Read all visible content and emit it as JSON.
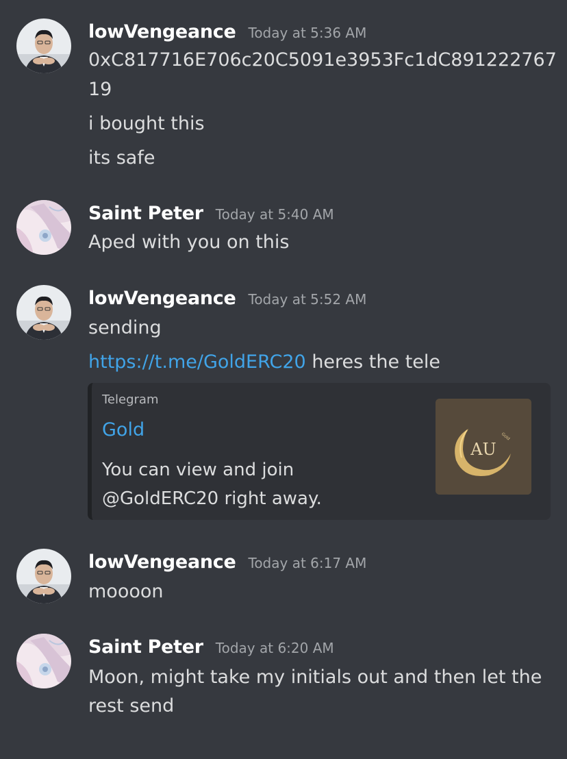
{
  "messages": [
    {
      "username": "lowVengeance",
      "timestamp": "Today at 5:36 AM",
      "lines": [
        "0xC817716E706c20C5091e3953Fc1dC891222767",
        "19",
        "i bought this",
        "its safe"
      ]
    },
    {
      "username": "Saint Peter",
      "timestamp": "Today at 5:40 AM",
      "lines": [
        "Aped with you on this"
      ]
    },
    {
      "username": "lowVengeance",
      "timestamp": "Today at 5:52 AM",
      "lines": [
        "sending"
      ],
      "link_text": "https://t.me/GoldERC20",
      "link_suffix": " heres the tele",
      "embed": {
        "provider": "Telegram",
        "title": "Gold",
        "description_line1": "You can view and join",
        "description_line2": "@GoldERC20 right away.",
        "thumb_text": "AU",
        "thumb_small_text": "Gold"
      }
    },
    {
      "username": "lowVengeance",
      "timestamp": "Today at 6:17 AM",
      "lines": [
        "moooon"
      ]
    },
    {
      "username": "Saint Peter",
      "timestamp": "Today at 6:20 AM",
      "lines": [
        "Moon, might take my initials out and then let the rest send"
      ]
    }
  ]
}
